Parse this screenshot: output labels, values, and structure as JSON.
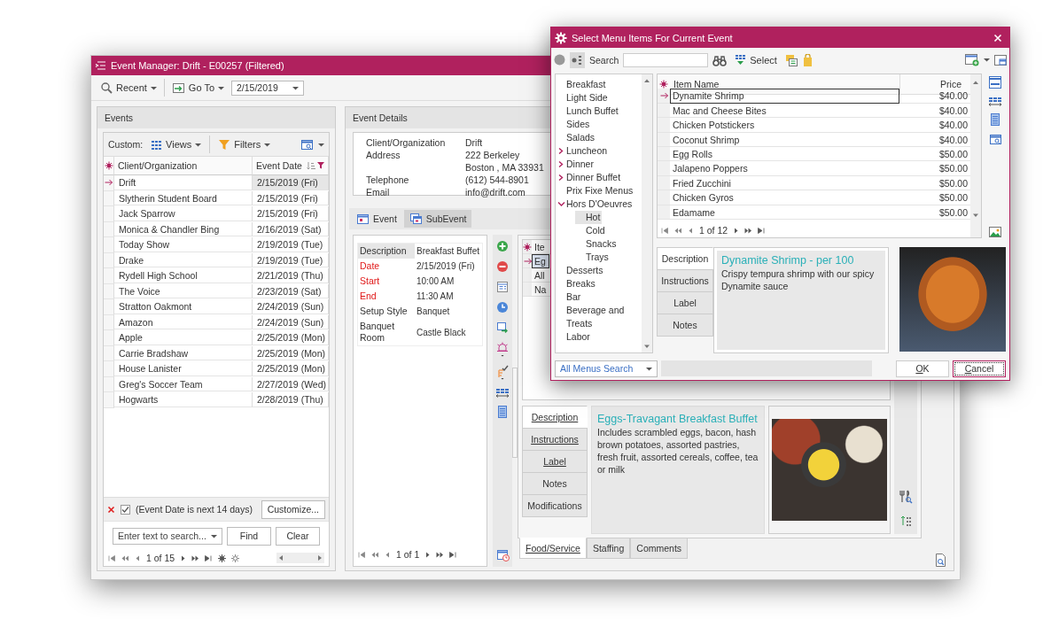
{
  "main_window": {
    "title": "Event Manager: Drift - E00257 (Filtered)",
    "toolbar": {
      "recent": "Recent",
      "go_to": "Go To",
      "date": "2/15/2019"
    },
    "events_panel": {
      "title": "Events",
      "custom_label": "Custom:",
      "views": "Views",
      "filters": "Filters",
      "columns": [
        "Client/Organization",
        "Event Date"
      ],
      "rows": [
        {
          "client": "Drift",
          "date": "2/15/2019 (Fri)",
          "selected": true
        },
        {
          "client": "Slytherin Student Board",
          "date": "2/15/2019 (Fri)",
          "selected": false
        },
        {
          "client": "Jack Sparrow",
          "date": "2/15/2019 (Fri)",
          "selected": false
        },
        {
          "client": "Monica & Chandler Bing",
          "date": "2/16/2019 (Sat)",
          "selected": false
        },
        {
          "client": "Today Show",
          "date": "2/19/2019 (Tue)",
          "selected": false
        },
        {
          "client": "Drake",
          "date": "2/19/2019 (Tue)",
          "selected": false
        },
        {
          "client": "Rydell High School",
          "date": "2/21/2019 (Thu)",
          "selected": false
        },
        {
          "client": "The Voice",
          "date": "2/23/2019 (Sat)",
          "selected": false
        },
        {
          "client": "Stratton Oakmont",
          "date": "2/24/2019 (Sun)",
          "selected": false
        },
        {
          "client": "Amazon",
          "date": "2/24/2019 (Sun)",
          "selected": false
        },
        {
          "client": "Apple",
          "date": "2/25/2019 (Mon)",
          "selected": false
        },
        {
          "client": "Carrie Bradshaw",
          "date": "2/25/2019 (Mon)",
          "selected": false
        },
        {
          "client": "House Lanister",
          "date": "2/25/2019 (Mon)",
          "selected": false
        },
        {
          "client": "Greg's Soccer Team",
          "date": "2/27/2019 (Wed)",
          "selected": false
        },
        {
          "client": "Hogwarts",
          "date": "2/28/2019 (Thu)",
          "selected": false
        }
      ],
      "filter": {
        "enabled": true,
        "text": "(Event Date is next 14 days)",
        "customize": "Customize..."
      },
      "search": {
        "placeholder": "Enter text to search...",
        "find": "Find",
        "clear": "Clear"
      },
      "pager": "1 of 15"
    },
    "details_panel": {
      "title": "Event Details",
      "client_info": [
        {
          "label": "Client/Organization",
          "lines": [
            "Drift"
          ]
        },
        {
          "label": "Address",
          "lines": [
            "222 Berkeley",
            "Boston , MA 33931"
          ]
        },
        {
          "label": "Telephone",
          "lines": [
            "(612) 544-8901"
          ]
        },
        {
          "label": "Email",
          "lines": [
            "info@drift.com"
          ]
        }
      ],
      "tabs": [
        {
          "label": "Event",
          "selected": false
        },
        {
          "label": "SubEvent",
          "selected": true
        }
      ],
      "subevent": {
        "properties": [
          {
            "label": "Description",
            "value": "Breakfast Buffet",
            "required": false,
            "selected": true
          },
          {
            "label": "Date",
            "value": "2/15/2019 (Fri)",
            "required": true,
            "selected": false
          },
          {
            "label": "Start",
            "value": "10:00 AM",
            "required": true,
            "selected": false
          },
          {
            "label": "End",
            "value": "11:30 AM",
            "required": true,
            "selected": false
          },
          {
            "label": "Setup Style",
            "value": "Banquet",
            "required": false,
            "selected": false
          },
          {
            "label": "Banquet Room",
            "value": "Castle Black",
            "required": false,
            "selected": false
          }
        ],
        "pager": "1 of 1"
      },
      "items_grid": {
        "column_1": "Ite",
        "rows": [
          {
            "text": "Eg",
            "selected": true
          },
          {
            "text": "All",
            "selected": false
          },
          {
            "text": "Na",
            "selected": false
          }
        ]
      },
      "info_tabs": [
        {
          "label": "Description",
          "selected": true,
          "underlined": true
        },
        {
          "label": "Instructions",
          "selected": false,
          "underlined": true
        },
        {
          "label": "Label",
          "selected": false,
          "underlined": true
        },
        {
          "label": "Notes",
          "selected": false,
          "underlined": false
        },
        {
          "label": "Modifications",
          "selected": false,
          "underlined": false
        }
      ],
      "item_title": "Eggs-Travagant Breakfast Buffet",
      "item_description": "Includes scrambled eggs, bacon, hash brown potatoes, assorted pastries, fresh fruit, assorted cereals, coffee, tea or milk",
      "bottom_tabs": [
        {
          "label": "Food/Service",
          "selected": true,
          "underlined": true
        },
        {
          "label": "Staffing",
          "selected": false,
          "underlined": false
        },
        {
          "label": "Comments",
          "selected": false,
          "underlined": false
        }
      ]
    }
  },
  "dialog": {
    "title": "Select Menu Items For Current Event",
    "search_label": "Search",
    "select": "Select",
    "menu_tree": [
      {
        "label": "Breakfast",
        "selected": false
      },
      {
        "label": "Light Side",
        "selected": false
      },
      {
        "label": "Lunch Buffet",
        "selected": false
      },
      {
        "label": "Sides",
        "selected": false
      },
      {
        "label": "Salads",
        "selected": false
      },
      {
        "label": "Luncheon",
        "selected": false,
        "expanded": false
      },
      {
        "label": "Dinner",
        "selected": false,
        "expanded": false
      },
      {
        "label": "Dinner Buffet",
        "selected": false,
        "expanded": false
      },
      {
        "label": "Prix Fixe Menus",
        "selected": false
      },
      {
        "label": "Hors D'Oeuvres",
        "selected": false,
        "expanded": true,
        "children": [
          {
            "label": "Hot",
            "selected": true
          },
          {
            "label": "Cold",
            "selected": false
          },
          {
            "label": "Snacks",
            "selected": false
          },
          {
            "label": "Trays",
            "selected": false
          }
        ]
      },
      {
        "label": "Desserts",
        "selected": false
      },
      {
        "label": "Breaks",
        "selected": false
      },
      {
        "label": "Bar",
        "selected": false
      },
      {
        "label": "Beverage and Treats",
        "selected": false
      },
      {
        "label": "Labor",
        "selected": false
      }
    ],
    "columns": [
      "Item Name",
      "Price"
    ],
    "items": [
      {
        "name": "Dynamite Shrimp",
        "price": "$40.00",
        "selected": true
      },
      {
        "name": "Mac and Cheese Bites",
        "price": "$40.00",
        "selected": false
      },
      {
        "name": "Chicken Potstickers",
        "price": "$40.00",
        "selected": false
      },
      {
        "name": "Coconut Shrimp",
        "price": "$40.00",
        "selected": false
      },
      {
        "name": "Egg Rolls",
        "price": "$50.00",
        "selected": false
      },
      {
        "name": "Jalapeno Poppers",
        "price": "$50.00",
        "selected": false
      },
      {
        "name": "Fried Zucchini",
        "price": "$50.00",
        "selected": false
      },
      {
        "name": "Chicken Gyros",
        "price": "$50.00",
        "selected": false
      },
      {
        "name": "Edamame",
        "price": "$50.00",
        "selected": false
      }
    ],
    "pager": "1 of 12",
    "info_tabs": [
      {
        "label": "Description",
        "selected": true
      },
      {
        "label": "Instructions",
        "selected": false
      },
      {
        "label": "Label",
        "selected": false
      },
      {
        "label": "Notes",
        "selected": false
      }
    ],
    "item_title": "Dynamite Shrimp - per 100",
    "item_description": "Crispy tempura shrimp with our spicy Dynamite sauce",
    "search_scope": "All Menus Search",
    "buttons": [
      {
        "label": "OK",
        "focused": false
      },
      {
        "label": "Cancel",
        "focused": true
      }
    ]
  }
}
